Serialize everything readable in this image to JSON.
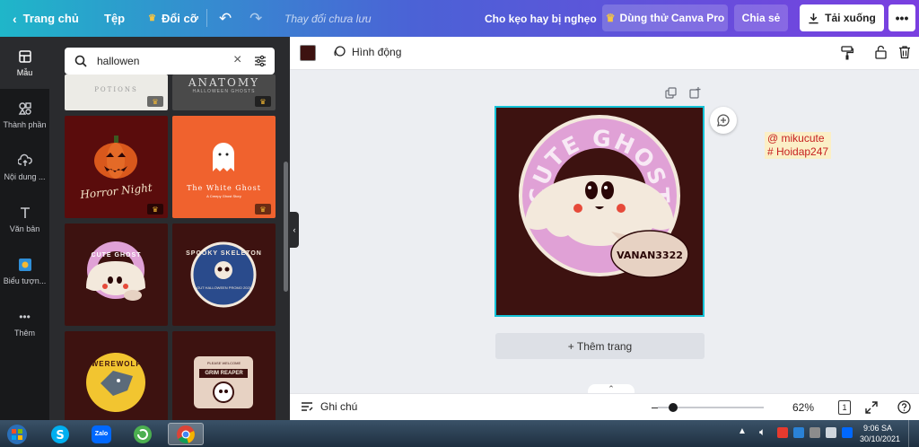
{
  "topbar": {
    "home_label": "Trang chủ",
    "file_label": "Tệp",
    "resize_label": "Đổi cỡ",
    "save_status": "Thay đổi chưa lưu",
    "doc_title": "Cho kẹo hay bị nghẹo",
    "try_pro_label": "Dùng thử Canva Pro",
    "share_label": "Chia sẻ",
    "download_label": "Tải xuống"
  },
  "rail": {
    "items": [
      {
        "label": "Mẫu",
        "icon": "template-icon"
      },
      {
        "label": "Thành phần",
        "icon": "elements-icon"
      },
      {
        "label": "Nội dung ...",
        "icon": "upload-icon"
      },
      {
        "label": "Văn bản",
        "icon": "text-icon"
      },
      {
        "label": "Biểu tượn...",
        "icon": "brand-icon"
      },
      {
        "label": "Thêm",
        "icon": "more-icon"
      }
    ]
  },
  "search": {
    "value": "hallowen"
  },
  "thumbnails": [
    {
      "title": "POTIONS",
      "bg": "#ecebe6",
      "premium": true
    },
    {
      "title": "ANATOMY",
      "subtitle": "HALLOWEEN GHOSTS",
      "bg": "#4a4a4a",
      "premium": true
    },
    {
      "title": "Horror Night",
      "bg": "#5a0c0c",
      "premium": true
    },
    {
      "title": "The White Ghost",
      "subtitle": "A Creepy Ghost Story",
      "bg": "#f0622e",
      "premium": true
    },
    {
      "title": "CUTE GHOST",
      "bg": "#3d1210",
      "premium": false
    },
    {
      "title": "SPOOKY SKELETON",
      "subtitle": "OUT HALLOWEEN PROMO 2021",
      "bg": "#3d1210",
      "premium": false
    },
    {
      "title": "WEREWOLF",
      "bg": "#3d1210",
      "premium": false
    },
    {
      "title": "GRIM REAPER",
      "subtitle": "PLEASE WELCOME",
      "bg": "#3d1210",
      "premium": false
    }
  ],
  "toolbar": {
    "animate_label": "Hình động",
    "color_swatch": "#3d1210"
  },
  "canvas": {
    "arc_text": "CUTE GHOST",
    "bubble_text": "VANAN3322",
    "bg": "#3d1210",
    "accent": "#e0a1d6"
  },
  "add_page_label": "+ Thêm trang",
  "overlay": {
    "line1": "@ mikucute",
    "line2": "# Hoidap247"
  },
  "bottombar": {
    "notes_label": "Ghi chú",
    "zoom": "62%",
    "page_count": "1"
  },
  "taskbar": {
    "time": "9:06 SA",
    "date": "30/10/2021",
    "zalo_label": "Zalo"
  }
}
